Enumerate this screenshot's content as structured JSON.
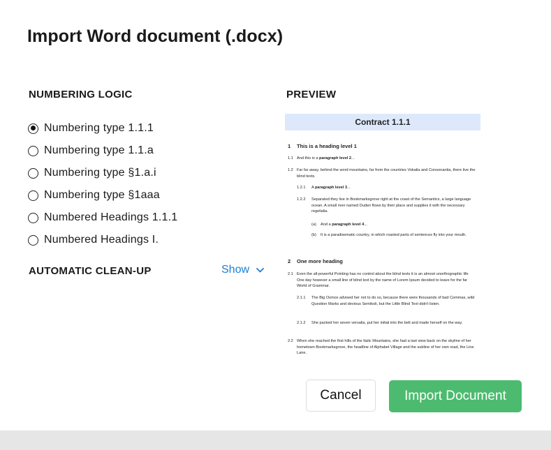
{
  "dialog": {
    "title": "Import Word document (.docx)"
  },
  "numbering": {
    "heading": "NUMBERING LOGIC",
    "options": [
      {
        "label": "Numbering type 1.1.1",
        "selected": true
      },
      {
        "label": "Numbering type 1.1.a",
        "selected": false
      },
      {
        "label": "Numbering type §1.a.i",
        "selected": false
      },
      {
        "label": "Numbering type §1aaa",
        "selected": false
      },
      {
        "label": "Numbered Headings 1.1.1",
        "selected": false
      },
      {
        "label": "Numbered Headings I.",
        "selected": false
      }
    ]
  },
  "cleanup": {
    "heading": "AUTOMATIC CLEAN-UP",
    "toggle_label": "Show",
    "toggle_icon": "chevron-down-icon"
  },
  "preview": {
    "heading": "PREVIEW",
    "doc_title": "Contract 1.1.1",
    "h1a_num": "1",
    "h1a_text": "This is a heading level 1",
    "p11_num": "1.1",
    "p11_pre": "And this is a ",
    "p11_bold": "paragraph level 2",
    "p11_post": "...",
    "p12_num": "1.2",
    "p12_text": "Far far away, behind the word mountains, far from the countries Vokalia and Consonantia, there live the blind texts.",
    "p121_num": "1.2.1",
    "p121_pre": "A ",
    "p121_bold": "paragraph level 3",
    "p121_post": "...",
    "p122_num": "1.2.2",
    "p122_text": "Separated they live in Bookmarksgrove right at the coast of the Semantics, a large language ocean. A small river named Duden flows by their place and supplies it with the necessary regelialia.",
    "pa_num": "(a)",
    "pa_pre": "And a ",
    "pa_bold": "paragraph level 4",
    "pa_post": "...",
    "pb_num": "(b)",
    "pb_text": "It is a paradisematic country, in which roasted parts of sentences fly into your mouth.",
    "h1b_num": "2",
    "h1b_text": "One more heading",
    "p21_num": "2.1",
    "p21_text": "Even the all-powerful Pointing has no control about the blind texts it is an almost unorthographic life One day however a small line of blind text by the name of Lorem Ipsum decided to leave for the far World of Grammar.",
    "p211_num": "2.1.1",
    "p211_text": "The Big Oxmox advised her not to do so, because there were thousands of bad Commas, wild Question Marks and devious Semikoli, but the Little Blind Text didn't listen.",
    "p212_num": "2.1.2",
    "p212_text": "She packed her seven versalia, put her initial into the belt and made herself on the way.",
    "p22_num": "2.2",
    "p22_text": "When she reached the first hills of the Italic Mountains, she had a last view back on the skyline of her hometown Bookmarksgrove, the headline of Alphabet Village and the subline of her own road, the Line Lane."
  },
  "actions": {
    "cancel_label": "Cancel",
    "import_label": "Import Document"
  },
  "colors": {
    "accent_link": "#1a7fd6",
    "primary_button": "#4cbb6f",
    "preview_title_bg": "#dde9fb"
  }
}
